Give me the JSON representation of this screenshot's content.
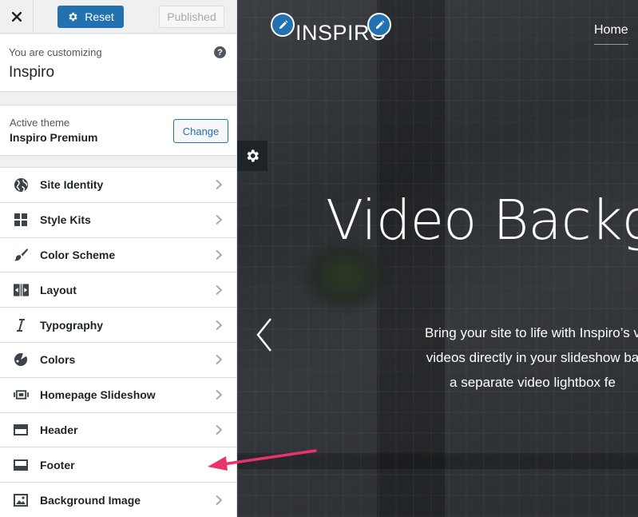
{
  "topbar": {
    "close_icon": "close-icon",
    "reset_label": "Reset",
    "published_label": "Published"
  },
  "customizing": {
    "label": "You are customizing",
    "site_name": "Inspiro",
    "help_glyph": "?"
  },
  "theme": {
    "label": "Active theme",
    "name": "Inspiro Premium",
    "change_label": "Change"
  },
  "sections": [
    {
      "label": "Site Identity",
      "icon": "globe-icon",
      "chevron": true
    },
    {
      "label": "Style Kits",
      "icon": "grid-icon",
      "chevron": true
    },
    {
      "label": "Color Scheme",
      "icon": "brush-icon",
      "chevron": true
    },
    {
      "label": "Layout",
      "icon": "layout-icon",
      "chevron": true
    },
    {
      "label": "Typography",
      "icon": "italic-icon",
      "chevron": true
    },
    {
      "label": "Colors",
      "icon": "palette-icon",
      "chevron": true
    },
    {
      "label": "Homepage Slideshow",
      "icon": "slides-icon",
      "chevron": true
    },
    {
      "label": "Header",
      "icon": "header-icon",
      "chevron": true
    },
    {
      "label": "Footer",
      "icon": "footer-icon",
      "chevron": false
    },
    {
      "label": "Background Image",
      "icon": "image-icon",
      "chevron": true
    }
  ],
  "preview": {
    "logo": "INSPIRO",
    "nav_home": "Home",
    "hero_title": "Video Backg",
    "hero_lines": [
      "Bring your site to life with Inspiro’s v",
      "videos directly in your slideshow ba",
      "a separate video lightbox fe"
    ]
  },
  "colors": {
    "accent": "#2271b1",
    "annotation_arrow": "#e8336b"
  }
}
